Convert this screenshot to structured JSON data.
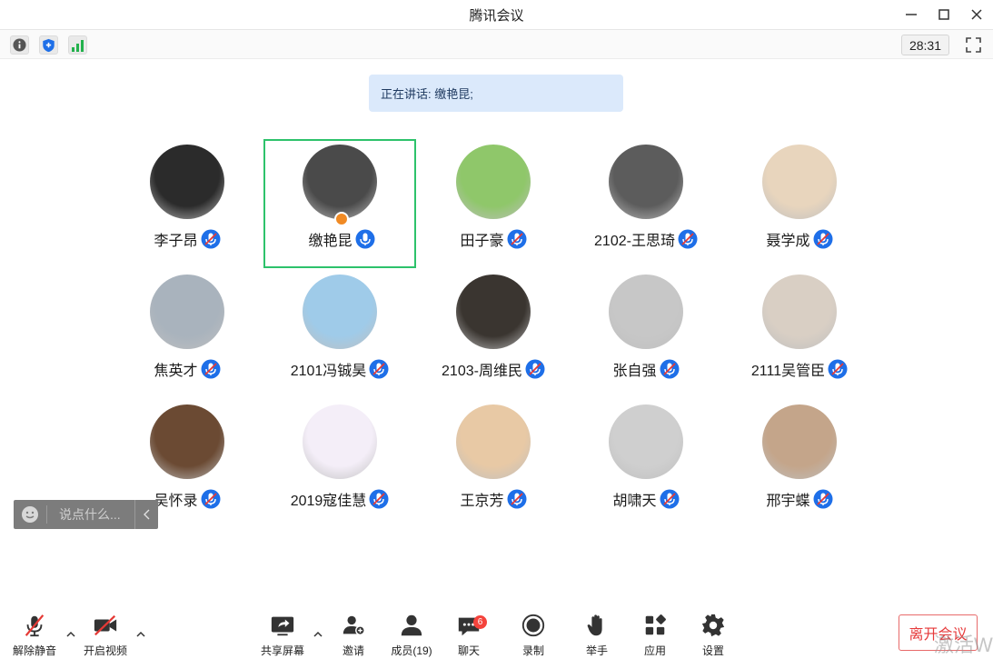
{
  "window": {
    "title": "腾讯会议"
  },
  "toolbar": {
    "timer": "28:31"
  },
  "banner": {
    "speaking_text": "正在讲话: 缴艳昆;"
  },
  "participants": [
    {
      "name": "李子昂",
      "avatar_color": "#2b2b2b",
      "mic": "muted"
    },
    {
      "name": "缴艳昆",
      "avatar_color": "#4a4a4a",
      "mic": "speaking",
      "active": true,
      "host": true
    },
    {
      "name": "田子豪",
      "avatar_color": "#8fc76a",
      "mic": "muted"
    },
    {
      "name": "2102-王思琦",
      "avatar_color": "#5c5c5c",
      "mic": "muted"
    },
    {
      "name": "聂学成",
      "avatar_color": "#e8d5bd",
      "mic": "muted"
    },
    {
      "name": "焦英才",
      "avatar_color": "#a9b3bd",
      "mic": "muted"
    },
    {
      "name": "2101冯铖昊",
      "avatar_color": "#9fcbe9",
      "mic": "muted"
    },
    {
      "name": "2103-周维民",
      "avatar_color": "#3a3530",
      "mic": "muted"
    },
    {
      "name": "张自强",
      "avatar_color": "#c7c7c7",
      "mic": "muted"
    },
    {
      "name": "2111吴管臣",
      "avatar_color": "#d9cfc4",
      "mic": "muted"
    },
    {
      "name": "吴怀录",
      "avatar_color": "#6b4a33",
      "mic": "muted"
    },
    {
      "name": "2019寇佳慧",
      "avatar_color": "#f4eef8",
      "mic": "muted"
    },
    {
      "name": "王京芳",
      "avatar_color": "#e8c9a5",
      "mic": "muted"
    },
    {
      "name": "胡啸天",
      "avatar_color": "#cfcfcf",
      "mic": "muted"
    },
    {
      "name": "邢宇蝶",
      "avatar_color": "#c4a58a",
      "mic": "muted"
    }
  ],
  "chat": {
    "placeholder": "说点什么..."
  },
  "bottombar": {
    "unmute": "解除静音",
    "start_video": "开启视频",
    "share_screen": "共享屏幕",
    "invite": "邀请",
    "members": "成员(19)",
    "chat": "聊天",
    "chat_badge": "6",
    "record": "录制",
    "raise_hand": "举手",
    "apps": "应用",
    "settings": "设置",
    "leave": "离开会议"
  },
  "watermark": "激活W",
  "colors": {
    "accent": "#1e6fe8",
    "active_border": "#2dc26b",
    "leave": "#e6393a"
  }
}
